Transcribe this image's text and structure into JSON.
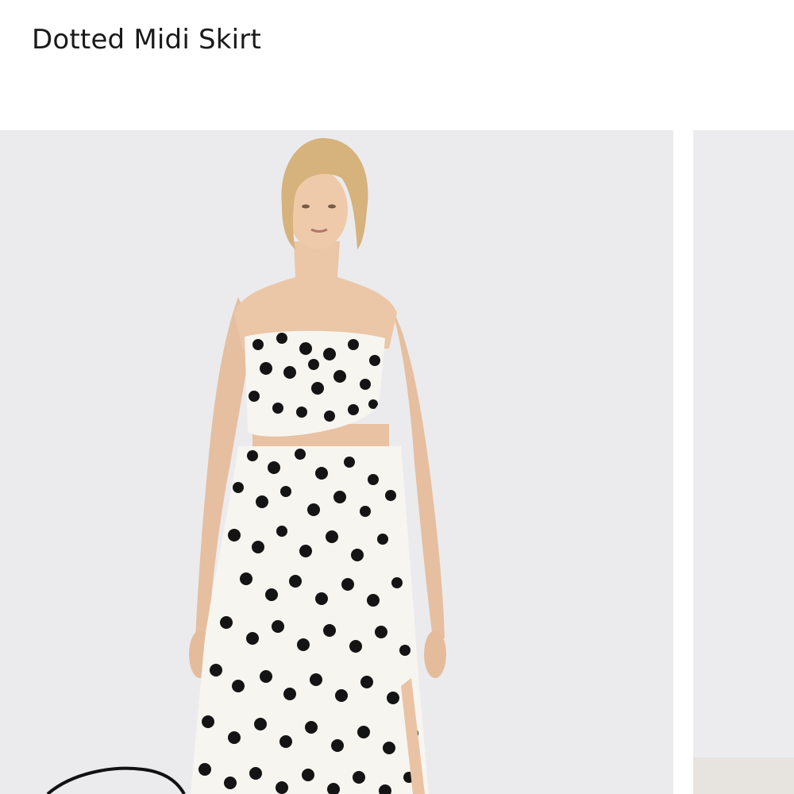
{
  "product": {
    "title": "Dotted Midi Skirt"
  },
  "gallery": {
    "main_image_subject": "model-wearing-polka-dot-strapless-top-and-midi-skirt",
    "has_next_image_preview": true
  },
  "colors": {
    "background": "#ffffff",
    "image_backdrop": "#ebebed",
    "fabric": "#f7f5f0",
    "dot": "#141414",
    "skin": "#e9c3a3",
    "hair": "#d4b07a",
    "title_text": "#1a1a1a"
  }
}
